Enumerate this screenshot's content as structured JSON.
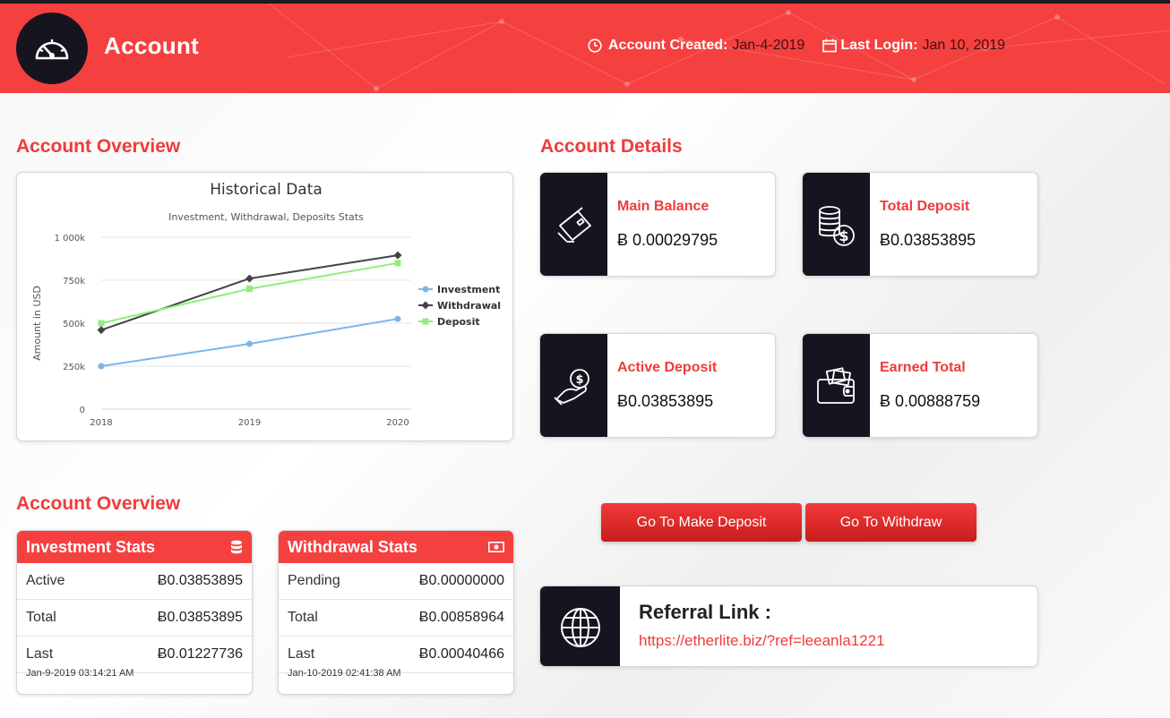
{
  "header": {
    "title": "Account",
    "created_label": "Account Created:",
    "created_value": "Jan-4-2019",
    "login_label": "Last Login:",
    "login_value": "Jan 10, 2019",
    "avatar_icon": "speedometer-icon"
  },
  "overview_title": "Account Overview",
  "details_title": "Account Details",
  "overview2_title": "Account Overview",
  "chart_data": {
    "type": "line",
    "title": "Historical Data",
    "subtitle": "Investment, Withdrawal, Deposits Stats",
    "ylabel": "Amount in USD",
    "xlabel": "",
    "x": [
      "2018",
      "2019",
      "2020"
    ],
    "ylim": [
      0,
      1000000
    ],
    "yticks": [
      0,
      250000,
      500000,
      750000,
      1000000
    ],
    "ytick_labels": [
      "0",
      "250k",
      "500k",
      "750k",
      "1 000k"
    ],
    "grid": true,
    "legend": "right",
    "series": [
      {
        "name": "Investment",
        "values": [
          250000,
          380000,
          525000
        ],
        "color": "#7cb5ec",
        "marker": "circle"
      },
      {
        "name": "Withdrawal",
        "values": [
          460000,
          760000,
          895000
        ],
        "color": "#434348",
        "marker": "diamond"
      },
      {
        "name": "Deposit",
        "values": [
          500000,
          700000,
          850000
        ],
        "color": "#90ed7d",
        "marker": "square"
      }
    ]
  },
  "details": [
    {
      "label": "Main Balance",
      "value": "Ƀ 0.00029795",
      "icon": "credit-card-icon"
    },
    {
      "label": "Total Deposit",
      "value": "Ƀ0.03853895",
      "icon": "coins-dollar-icon"
    },
    {
      "label": "Active Deposit",
      "value": "Ƀ0.03853895",
      "icon": "hand-coin-icon"
    },
    {
      "label": "Earned Total",
      "value": "Ƀ 0.00888759",
      "icon": "wallet-icon"
    }
  ],
  "buttons": {
    "deposit": "Go To Make Deposit",
    "withdraw": "Go To Withdraw"
  },
  "referral": {
    "title": "Referral Link :",
    "link": "https://etherlite.biz/?ref=leeanla1221",
    "icon": "globe-icon"
  },
  "investment_stats": {
    "title": "Investment Stats",
    "icon": "database-icon",
    "rows": [
      {
        "label": "Active",
        "value": "Ƀ0.03853895"
      },
      {
        "label": "Total",
        "value": "Ƀ0.03853895"
      },
      {
        "label": "Last",
        "value": "Ƀ0.01227736"
      }
    ],
    "last_time": "Jan-9-2019 03:14:21 AM"
  },
  "withdrawal_stats": {
    "title": "Withdrawal Stats",
    "icon": "money-bill-icon",
    "rows": [
      {
        "label": "Pending",
        "value": "Ƀ0.00000000"
      },
      {
        "label": "Total",
        "value": "Ƀ0.00858964"
      },
      {
        "label": "Last",
        "value": "Ƀ0.00040466"
      }
    ],
    "last_time": "Jan-10-2019 02:41:38 AM"
  }
}
